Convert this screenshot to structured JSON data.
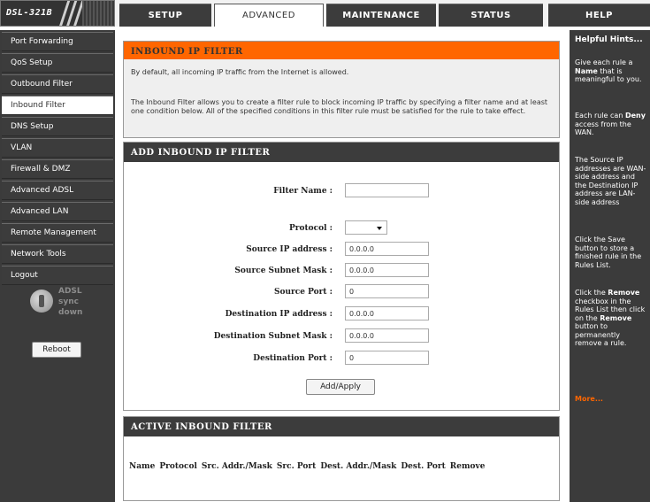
{
  "logo": {
    "model": "DSL-321B"
  },
  "tabs": [
    {
      "label": "SETUP"
    },
    {
      "label": "ADVANCED"
    },
    {
      "label": "MAINTENANCE"
    },
    {
      "label": "STATUS"
    },
    {
      "label": "HELP"
    }
  ],
  "nav": {
    "items": [
      {
        "label": "Port Forwarding"
      },
      {
        "label": "QoS Setup"
      },
      {
        "label": "Outbound Filter"
      },
      {
        "label": "Inbound Filter"
      },
      {
        "label": "DNS Setup"
      },
      {
        "label": "VLAN"
      },
      {
        "label": "Firewall & DMZ"
      },
      {
        "label": "Advanced ADSL"
      },
      {
        "label": "Advanced LAN"
      },
      {
        "label": "Remote Management"
      },
      {
        "label": "Network Tools"
      },
      {
        "label": "Logout"
      }
    ],
    "adsl_line1": "ADSL",
    "adsl_line2": "sync",
    "adsl_line3": "down",
    "reboot_label": "Reboot"
  },
  "intro": {
    "title": "INBOUND IP FILTER",
    "p1": "By default, all incoming IP traffic from the Internet is allowed.",
    "p2": "The Inbound Filter allows you to create a filter rule to block incoming IP traffic by specifying a filter name and at least one condition below. All of the specified conditions in this filter rule must be satisfied for the rule to take effect."
  },
  "add_filter": {
    "title": "ADD INBOUND IP FILTER",
    "filter_name_label": "Filter Name :",
    "filter_name_value": "",
    "protocol_label": "Protocol :",
    "protocol_value": "",
    "src_ip_label": "Source IP address :",
    "src_ip_value": "0.0.0.0",
    "src_mask_label": "Source Subnet Mask :",
    "src_mask_value": "0.0.0.0",
    "src_port_label": "Source Port :",
    "src_port_value": "0",
    "dst_ip_label": "Destination IP address :",
    "dst_ip_value": "0.0.0.0",
    "dst_mask_label": "Destination Subnet Mask :",
    "dst_mask_value": "0.0.0.0",
    "dst_port_label": "Destination Port :",
    "dst_port_value": "0",
    "apply_label": "Add/Apply"
  },
  "active_filter": {
    "title": "ACTIVE INBOUND FILTER",
    "columns": [
      "Name",
      "Protocol",
      "Src. Addr./Mask",
      "Src. Port",
      "Dest. Addr./Mask",
      "Dest. Port",
      "Remove"
    ]
  },
  "help": {
    "title": "Helpful Hints...",
    "h1_a": "Give each rule a ",
    "h1_b": "Name",
    "h1_c": " that is meaningful to you.",
    "h2_a": "Each rule can ",
    "h2_b": "Deny",
    "h2_c": " access from the WAN.",
    "h3": "The Source IP addresses are WAN-side address and the Destination IP address are LAN-side address",
    "h4": "Click the Save button to store a finished rule in the Rules List.",
    "h5_a": "Click the ",
    "h5_b": "Remove",
    "h5_c": " checkbox in the Rules List then click on the ",
    "h5_d": "Remove",
    "h5_e": " button to permanently remove a rule.",
    "more": "More..."
  },
  "colors": {
    "accent": "#ff6600",
    "dark": "#3c3c3c",
    "panel_bg": "#efefef"
  }
}
